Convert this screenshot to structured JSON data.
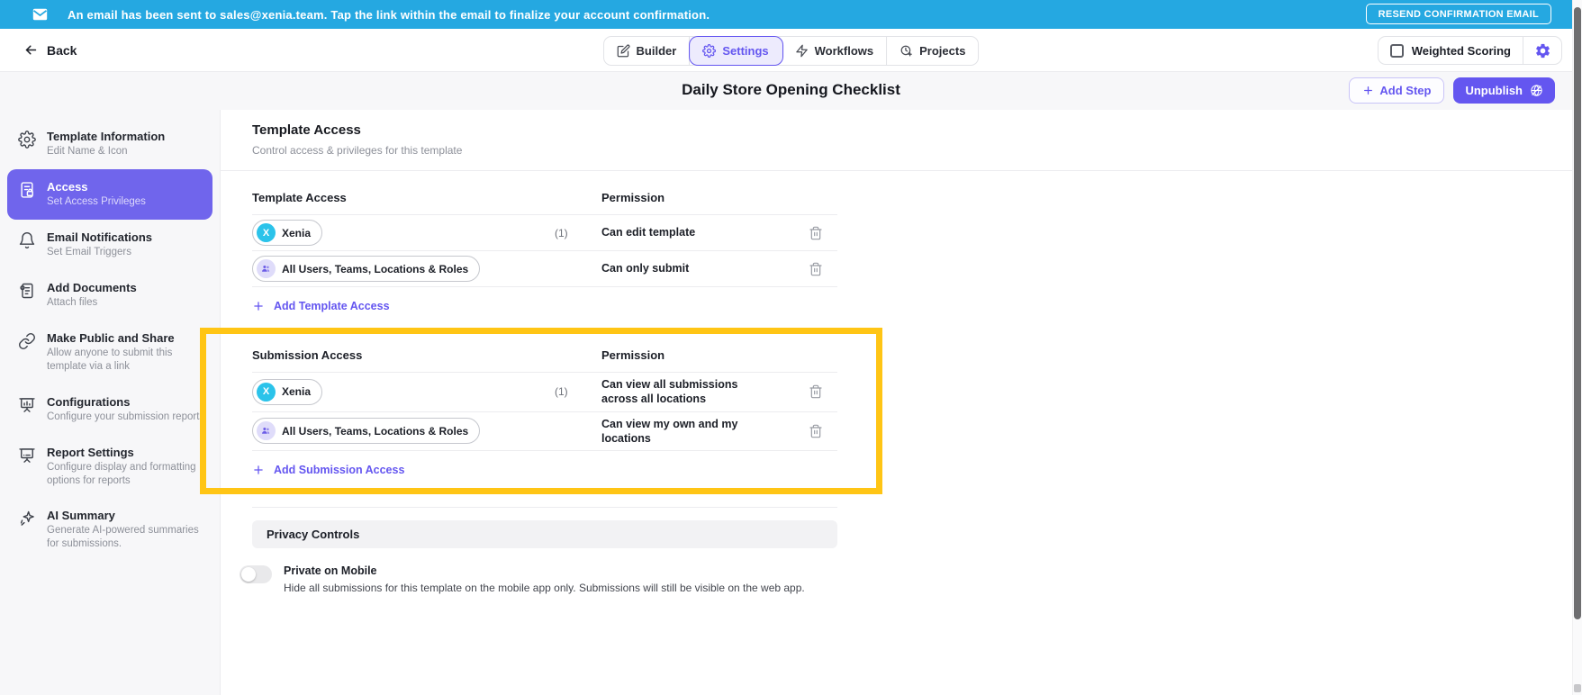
{
  "banner": {
    "message": "An email has been sent to sales@xenia.team. Tap the link within the email to finalize your account confirmation.",
    "button_label": "RESEND CONFIRMATION EMAIL"
  },
  "header": {
    "back_label": "Back",
    "tabs": [
      {
        "label": "Builder",
        "icon": "pencil-icon",
        "active": false
      },
      {
        "label": "Settings",
        "icon": "gear-icon",
        "active": true
      },
      {
        "label": "Workflows",
        "icon": "lightning-icon",
        "active": false
      },
      {
        "label": "Projects",
        "icon": "clock-plus-icon",
        "active": false
      }
    ],
    "weighted_scoring_label": "Weighted Scoring",
    "weighted_scoring_checked": false
  },
  "titlebar": {
    "title": "Daily Store Opening Checklist",
    "add_step_label": "Add Step",
    "unpublish_label": "Unpublish"
  },
  "sidebar": {
    "items": [
      {
        "title": "Template Information",
        "subtitle": "Edit Name & Icon",
        "icon": "gear-icon",
        "active": false
      },
      {
        "title": "Access",
        "subtitle": "Set Access Privileges",
        "icon": "document-lock-icon",
        "active": true
      },
      {
        "title": "Email Notifications",
        "subtitle": "Set Email Triggers",
        "icon": "bell-icon",
        "active": false
      },
      {
        "title": "Add Documents",
        "subtitle": "Attach files",
        "icon": "document-attachment-icon",
        "active": false
      },
      {
        "title": "Make Public and Share",
        "subtitle": "Allow anyone to submit this template via a link",
        "icon": "link-icon",
        "active": false
      },
      {
        "title": "Configurations",
        "subtitle": "Configure your submission reports",
        "icon": "presentation-board-icon",
        "active": false
      },
      {
        "title": "Report Settings",
        "subtitle": "Configure display and formatting options for reports",
        "icon": "presentation-board-icon",
        "active": false
      },
      {
        "title": "AI Summary",
        "subtitle": "Generate AI-powered summaries for submissions.",
        "icon": "sparkle-icon",
        "active": false
      }
    ]
  },
  "main": {
    "heading": "Template Access",
    "subheading": "Control access & privileges for this template",
    "template_access": {
      "col1": "Template Access",
      "col2": "Permission",
      "rows": [
        {
          "chip": "Xenia",
          "avatar_initial": "X",
          "count": "(1)",
          "permission": "Can edit template"
        },
        {
          "chip": "All Users, Teams, Locations & Roles",
          "count": "",
          "permission": "Can only submit"
        }
      ],
      "add_label": "Add Template Access"
    },
    "submission_access": {
      "col1": "Submission Access",
      "col2": "Permission",
      "rows": [
        {
          "chip": "Xenia",
          "avatar_initial": "X",
          "count": "(1)",
          "permission": "Can view all submissions across all locations"
        },
        {
          "chip": "All Users, Teams, Locations & Roles",
          "count": "",
          "permission": "Can view my own and my locations"
        }
      ],
      "add_label": "Add Submission Access"
    },
    "privacy": {
      "heading": "Privacy Controls",
      "toggle_label": "Private on Mobile",
      "toggle_description": "Hide all submissions for this template on the mobile app only. Submissions will still be visible on the web app.",
      "toggle_on": false
    }
  },
  "colors": {
    "banner_blue": "#25A8E1",
    "accent_purple": "#6456F0",
    "sidebar_selected_purple": "#7065EC",
    "highlight_yellow": "#FFC515",
    "xenia_avatar_cyan": "#2BC3EA",
    "users_avatar_purple": "#DFDCFA"
  }
}
